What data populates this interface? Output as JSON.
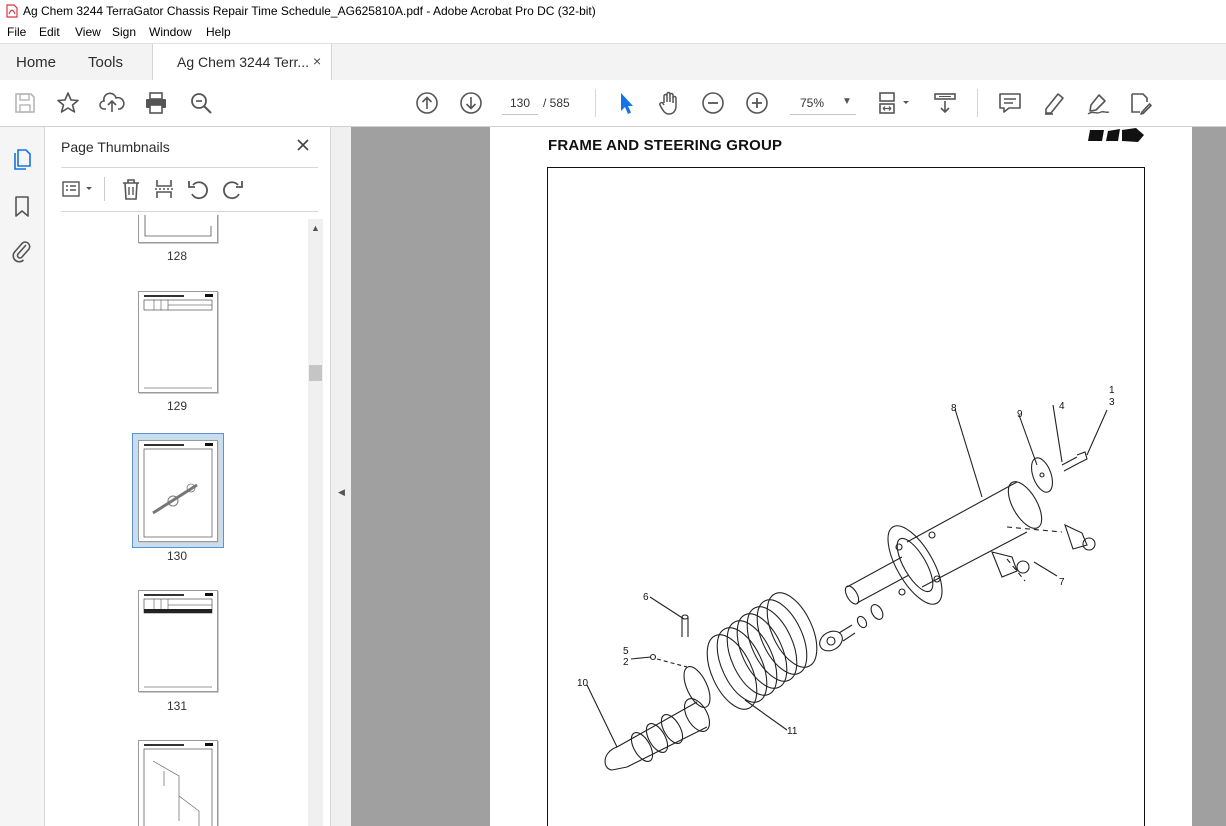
{
  "window": {
    "title": "Ag Chem 3244 TerraGator Chassis Repair Time Schedule_AG625810A.pdf - Adobe Acrobat Pro DC (32-bit)"
  },
  "menu": [
    "File",
    "Edit",
    "View",
    "Sign",
    "Window",
    "Help"
  ],
  "tabs": {
    "home": "Home",
    "tools": "Tools",
    "document": "Ag Chem 3244 Terr...",
    "close_symbol": "×"
  },
  "toolbar": {
    "icons": [
      "save-icon",
      "bookmark-star-icon",
      "upload-icon",
      "print-icon",
      "zoom-search-icon",
      "page-up-icon",
      "page-down-icon",
      "select-arrow-icon",
      "hand-icon",
      "zoom-out-icon",
      "zoom-in-icon",
      "fit-page-icon",
      "scroll-mode-icon",
      "comment-icon",
      "highlight-icon",
      "sign-icon",
      "edit-pdf-icon"
    ],
    "current_page": "130",
    "page_separator": "/ 585",
    "zoom": "75%"
  },
  "panel": {
    "title": "Page Thumbnails",
    "thumbnails": [
      {
        "label": "128"
      },
      {
        "label": "129"
      },
      {
        "label": "130",
        "selected": true
      },
      {
        "label": "131"
      }
    ]
  },
  "document": {
    "heading": "FRAME AND STEERING GROUP",
    "callouts": [
      "1",
      "3",
      "8",
      "9",
      "4",
      "7",
      "6",
      "5",
      "2",
      "10",
      "11"
    ]
  },
  "colors": {
    "accent": "#1473e6",
    "tab_bar": "#f3f3f3",
    "doc_background": "#a0a0a0",
    "selected_thumb": "#c9ddf1"
  }
}
